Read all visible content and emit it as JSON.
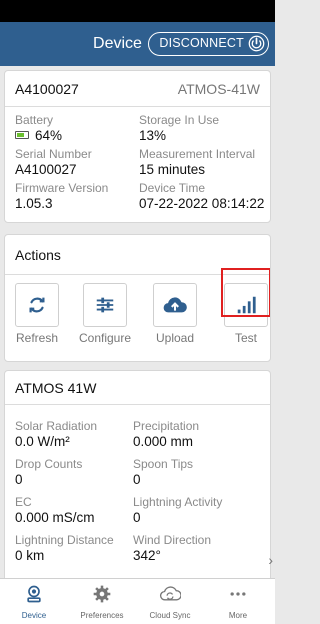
{
  "nav": {
    "title": "Device",
    "disconnect_label": "DISCONNECT"
  },
  "device": {
    "id": "A4100027",
    "model": "ATMOS-41W",
    "battery_label": "Battery",
    "battery_value": "64%",
    "battery_level": 0.64,
    "storage_label": "Storage In Use",
    "storage_value": "13%",
    "serial_label": "Serial Number",
    "serial_value": "A4100027",
    "interval_label": "Measurement Interval",
    "interval_value": "15 minutes",
    "firmware_label": "Firmware Version",
    "firmware_value": "1.05.3",
    "time_label": "Device Time",
    "time_value": "07-22-2022 08:14:22"
  },
  "actions": {
    "title": "Actions",
    "items": [
      {
        "label": "Refresh",
        "icon": "refresh-icon"
      },
      {
        "label": "Configure",
        "icon": "sliders-icon"
      },
      {
        "label": "Upload",
        "icon": "cloud-upload-icon"
      },
      {
        "label": "Test",
        "icon": "signal-bars-icon"
      }
    ],
    "accent": "#2f5f8f",
    "highlight_color": "#e02020"
  },
  "sensor": {
    "title": "ATMOS 41W",
    "fields": [
      {
        "label": "Solar Radiation",
        "value": "0.0 W/m²"
      },
      {
        "label": "Precipitation",
        "value": "0.000 mm"
      },
      {
        "label": "Drop Counts",
        "value": "0"
      },
      {
        "label": "Spoon Tips",
        "value": "0"
      },
      {
        "label": "EC",
        "value": "0.000 mS/cm"
      },
      {
        "label": "Lightning Activity",
        "value": "0"
      },
      {
        "label": "Lightning Distance",
        "value": "0 km"
      },
      {
        "label": "Wind Direction",
        "value": "342°"
      }
    ]
  },
  "tabs": [
    {
      "label": "Device",
      "icon": "device-icon",
      "active": true
    },
    {
      "label": "Preferences",
      "icon": "gear-icon",
      "active": false
    },
    {
      "label": "Cloud Sync",
      "icon": "cloud-sync-icon",
      "active": false
    },
    {
      "label": "More",
      "icon": "more-icon",
      "active": false
    }
  ]
}
